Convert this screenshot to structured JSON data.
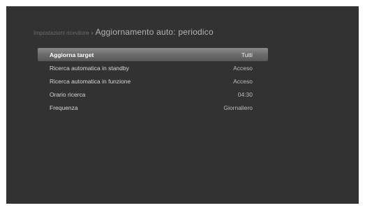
{
  "screen": {
    "breadcrumb_path": "Impostazioni ricevitore",
    "breadcrumb_separator": "›",
    "title": "Aggiornamento auto: periodico"
  },
  "settings": [
    {
      "label": "Aggiorna target",
      "value": "Tutti",
      "selected": true
    },
    {
      "label": "Ricerca automatica in standby",
      "value": "Acceso",
      "selected": false
    },
    {
      "label": "Ricerca automatica in funzione",
      "value": "Acceso",
      "selected": false
    },
    {
      "label": "Orario ricerca",
      "value": "04:30",
      "selected": false
    },
    {
      "label": "Frequenza",
      "value": "Giornaliero",
      "selected": false
    }
  ],
  "colors": {
    "background": "#323232",
    "text": "#d9d9d9",
    "highlight": "#7a7a7a"
  }
}
